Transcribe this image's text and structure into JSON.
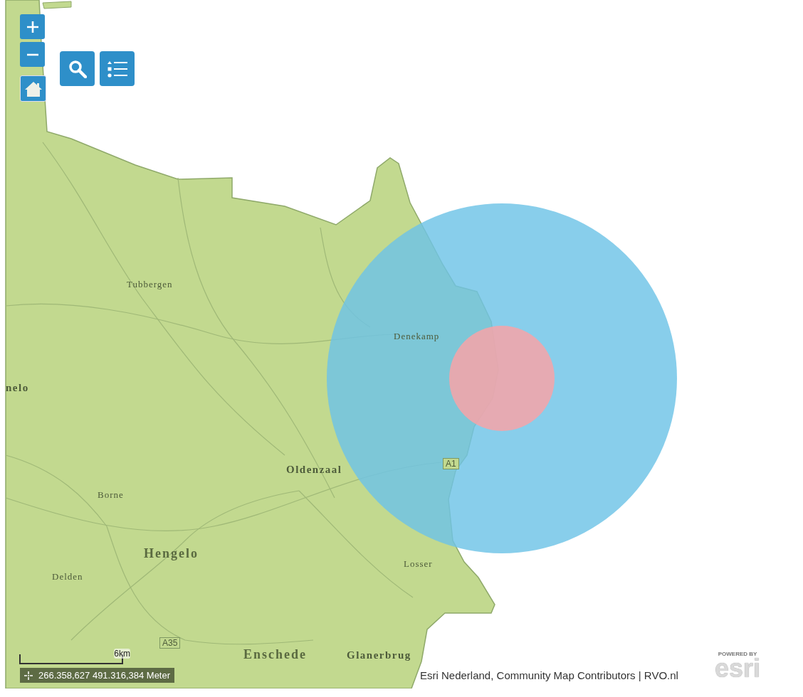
{
  "map": {
    "labels": [
      {
        "kind": "town",
        "text": "Tubbergen"
      },
      {
        "kind": "town",
        "text": "Denekamp"
      },
      {
        "kind": "city",
        "text": "nelo"
      },
      {
        "kind": "city",
        "text": "Oldenzaal"
      },
      {
        "kind": "town",
        "text": "Borne"
      },
      {
        "kind": "large",
        "text": "Hengelo"
      },
      {
        "kind": "town",
        "text": "Delden"
      },
      {
        "kind": "town",
        "text": "Losser"
      },
      {
        "kind": "large",
        "text": "Enschede"
      },
      {
        "kind": "city",
        "text": "Glanerbrug"
      },
      {
        "kind": "road",
        "text": "A1"
      },
      {
        "kind": "road",
        "text": "A35"
      }
    ]
  },
  "scale_bar": {
    "label": "6km"
  },
  "coordinates": {
    "value": "266.358,627 491.316,384 Meter"
  },
  "attribution": "Esri Nederland, Community Map Contributors | RVO.nl",
  "logo": {
    "tagline": "POWERED BY",
    "wordmark": "esri"
  }
}
